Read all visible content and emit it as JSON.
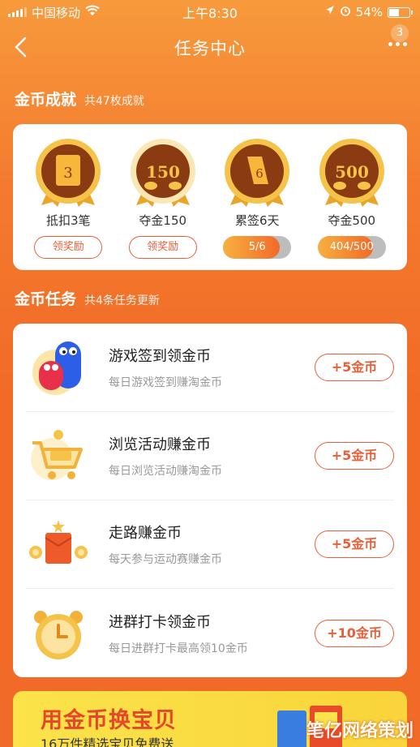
{
  "status": {
    "carrier": "中国移动",
    "time": "上午8:30",
    "battery": "54%",
    "battery_level": 0.54
  },
  "nav": {
    "title": "任务中心",
    "badge": "3"
  },
  "achievements_section": {
    "title": "金币成就",
    "subtitle": "共47枚成就"
  },
  "achievements": [
    {
      "name": "抵扣3笔",
      "medal_text": "3",
      "action": "领奖励"
    },
    {
      "name": "夺金150",
      "medal_text": "150",
      "action": "领奖励"
    },
    {
      "name": "累签6天",
      "medal_text": "6",
      "progress_text": "5/6",
      "progress": 0.833
    },
    {
      "name": "夺金500",
      "medal_text": "500",
      "progress_text": "404/500",
      "progress": 0.808
    }
  ],
  "tasks_section": {
    "title": "金币任务",
    "subtitle": "共4条任务更新"
  },
  "tasks": [
    {
      "title": "游戏签到领金币",
      "desc": "每日游戏签到赚淘金币",
      "reward": "+5金币",
      "icon": "game-characters-icon"
    },
    {
      "title": "浏览活动赚金币",
      "desc": "每日浏览活动赚淘金币",
      "reward": "+5金币",
      "icon": "shopping-cart-icon"
    },
    {
      "title": "走路赚金币",
      "desc": "每天参与运动赛赚金币",
      "reward": "+5金币",
      "icon": "red-envelope-icon"
    },
    {
      "title": "进群打卡领金币",
      "desc": "每日进群打卡最高领10金币",
      "reward": "+10金币",
      "icon": "alarm-clock-icon"
    }
  ],
  "banner": {
    "title": "用金币换宝贝",
    "subtitle": "16万件精选宝贝免费送"
  },
  "watermark": "笔亿网络策划",
  "colors": {
    "accent": "#e8603a",
    "background": "#f47a2e",
    "gold": "#f5b630"
  }
}
